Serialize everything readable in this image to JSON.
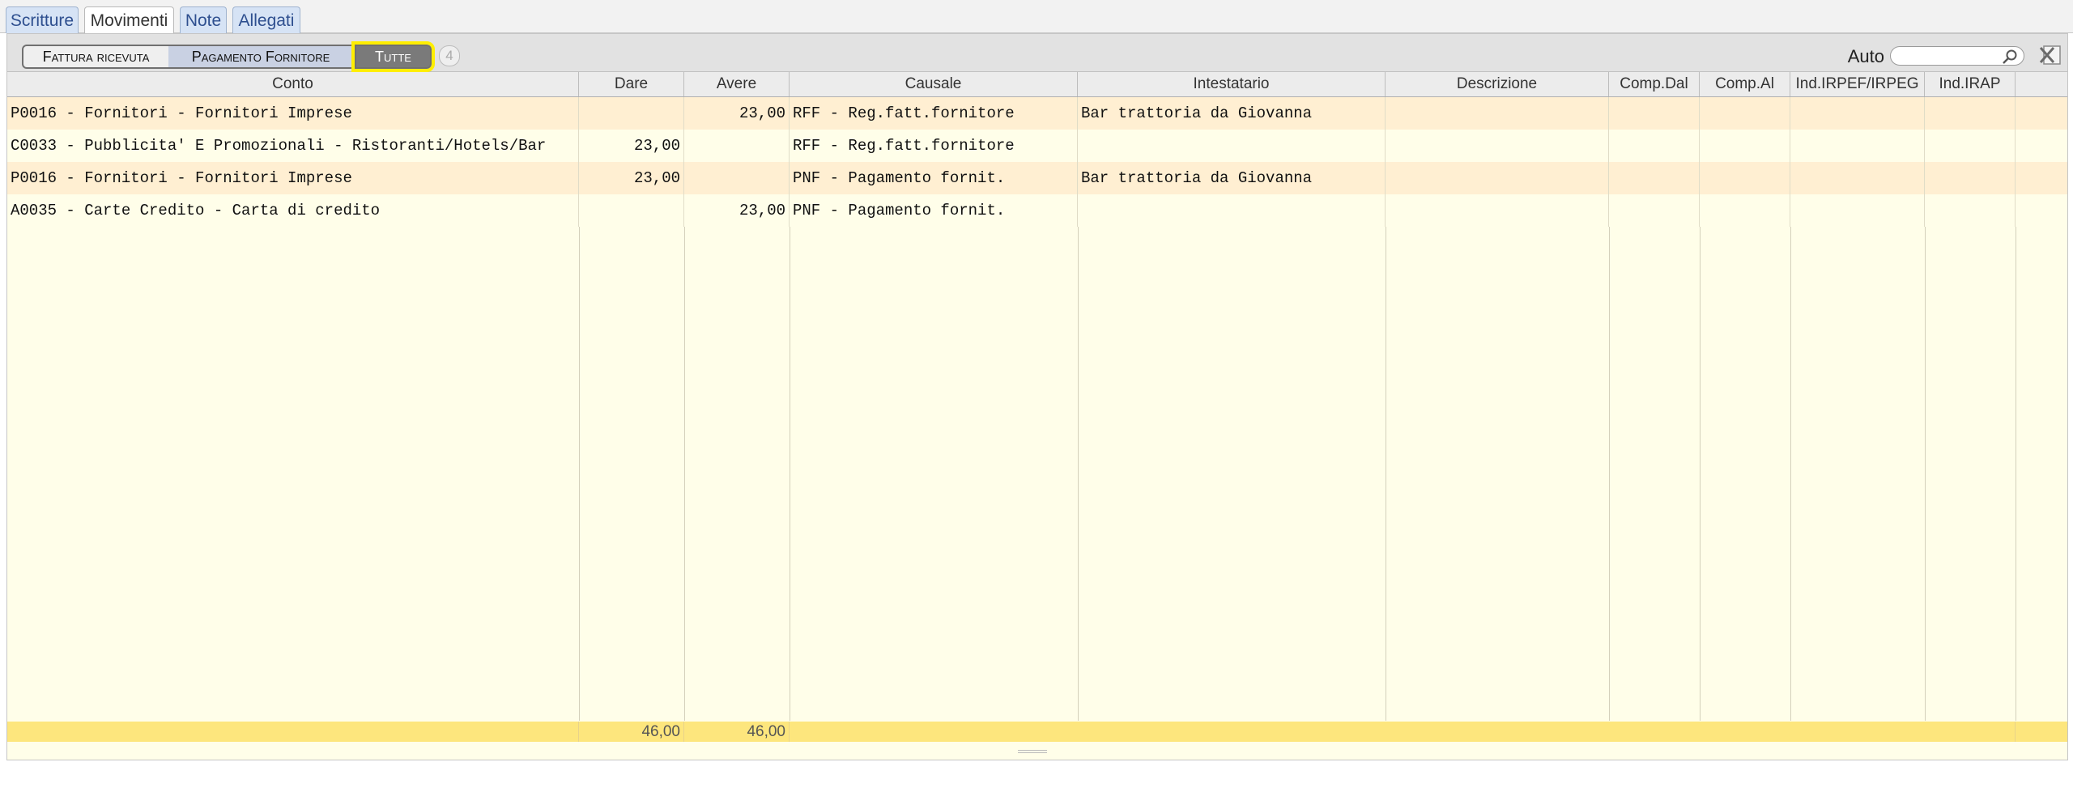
{
  "tabs": [
    {
      "label": "Scritture",
      "active": false
    },
    {
      "label": "Movimenti",
      "active": true
    },
    {
      "label": "Note",
      "active": false
    },
    {
      "label": "Allegati",
      "active": false
    }
  ],
  "filters": {
    "fattura": "Fattura ricevuta",
    "pagamento": "Pagamento Fornitore",
    "tutte": "Tutte",
    "count": "4"
  },
  "search": {
    "label": "Auto",
    "value": ""
  },
  "columns": [
    "Conto",
    "Dare",
    "Avere",
    "Causale",
    "Intestatario",
    "Descrizione",
    "Comp.Dal",
    "Comp.Al",
    "Ind.IRPEF/IRPEG",
    "Ind.IRAP",
    ""
  ],
  "rows": [
    {
      "conto": "P0016 - Fornitori - Fornitori Imprese",
      "dare": "",
      "avere": "23,00",
      "causale": "RFF - Reg.fatt.fornitore",
      "intestatario": "Bar trattoria da Giovanna",
      "descrizione": "",
      "comp_dal": "",
      "comp_al": "",
      "irpef": "",
      "irap": ""
    },
    {
      "conto": "C0033 - Pubblicita' E Promozionali - Ristoranti/Hotels/Bar",
      "dare": "23,00",
      "avere": "",
      "causale": "RFF - Reg.fatt.fornitore",
      "intestatario": "",
      "descrizione": "",
      "comp_dal": "",
      "comp_al": "",
      "irpef": "",
      "irap": ""
    },
    {
      "conto": "P0016 - Fornitori - Fornitori Imprese",
      "dare": "23,00",
      "avere": "",
      "causale": "PNF - Pagamento fornit.",
      "intestatario": "Bar trattoria da Giovanna",
      "descrizione": "",
      "comp_dal": "",
      "comp_al": "",
      "irpef": "",
      "irap": ""
    },
    {
      "conto": "A0035 - Carte Credito - Carta di credito",
      "dare": "",
      "avere": "23,00",
      "causale": "PNF - Pagamento fornit.",
      "intestatario": "",
      "descrizione": "",
      "comp_dal": "",
      "comp_al": "",
      "irpef": "",
      "irap": ""
    }
  ],
  "totals": {
    "dare": "46,00",
    "avere": "46,00"
  },
  "colors": {
    "row_odd": "#ffefd2",
    "row_even": "#fffee9",
    "total_bar": "#fde67d",
    "highlight": "#ffee00",
    "tab_inactive": "#d6e3f5"
  },
  "icons": {
    "search": "magnifier-icon",
    "excel": "excel-export-icon"
  }
}
